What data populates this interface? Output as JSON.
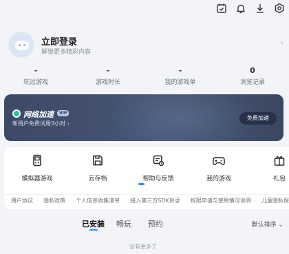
{
  "topbar": {
    "icons": [
      "calendar-check-icon",
      "bell-icon",
      "download-icon",
      "settings-icon"
    ]
  },
  "profile": {
    "title": "立即登录",
    "subtitle": "解锁更多精彩内容"
  },
  "stats": [
    {
      "value": "-",
      "label": "玩过游戏"
    },
    {
      "value": "-",
      "label": "游戏时长"
    },
    {
      "value": "-",
      "label": "我的游戏单"
    },
    {
      "value": "0",
      "label": "浏览记录"
    }
  ],
  "accelerator": {
    "title": "网络加速",
    "badge": "VIP",
    "subtitle": "新用户免费试用3小时 ›",
    "button": "免费加速",
    "colors": {
      "accent": "#2fbf9a",
      "background": "#3c4a67"
    }
  },
  "tools": [
    {
      "label": "模拟器游戏",
      "icon": "emulator-icon"
    },
    {
      "label": "云存档",
      "icon": "cloud-save-icon"
    },
    {
      "label": "帮助与反馈",
      "icon": "help-feedback-icon"
    },
    {
      "label": "我的游戏",
      "icon": "gamepad-icon"
    },
    {
      "label": "礼包",
      "icon": "gift-icon"
    }
  ],
  "links": [
    "用户协议",
    "隐私政策",
    "个人信息收集清单",
    "接入第三方SDK目录",
    "权限申请与使用情况说明",
    "儿童隐私保"
  ],
  "tabs": [
    {
      "label": "已安装",
      "active": true
    },
    {
      "label": "畅玩",
      "active": false
    },
    {
      "label": "预约",
      "active": false
    }
  ],
  "sort": "默认排序 ⌄",
  "empty_text": "没有更多了",
  "watermark": "www.cbish.com",
  "colors": {
    "primary": "#2b8ff0"
  }
}
